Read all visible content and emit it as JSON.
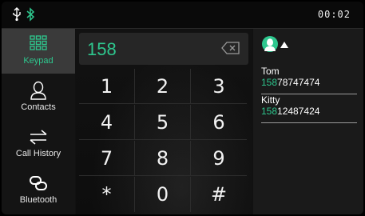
{
  "status": {
    "time": "00:02",
    "usb_icon": "usb-icon",
    "bluetooth_icon": "bluetooth-icon",
    "bluetooth_color": "#2ec78e"
  },
  "sidebar": {
    "items": [
      {
        "label": "Keypad",
        "icon": "keypad-icon",
        "active": true
      },
      {
        "label": "Contacts",
        "icon": "contacts-icon",
        "active": false
      },
      {
        "label": "Call History",
        "icon": "call-history-icon",
        "active": false
      },
      {
        "label": "Bluetooth",
        "icon": "link-icon",
        "active": false
      }
    ]
  },
  "dialer": {
    "entered_number": "158",
    "keys": [
      "1",
      "2",
      "3",
      "4",
      "5",
      "6",
      "7",
      "8",
      "9",
      "*",
      "0",
      "#"
    ]
  },
  "contacts": {
    "results": [
      {
        "name": "Tom",
        "match": "158",
        "rest": "78747474"
      },
      {
        "name": "Kitty",
        "match": "158",
        "rest": "12487424"
      }
    ]
  },
  "colors": {
    "accent": "#2ec78e",
    "background": "#111111"
  }
}
